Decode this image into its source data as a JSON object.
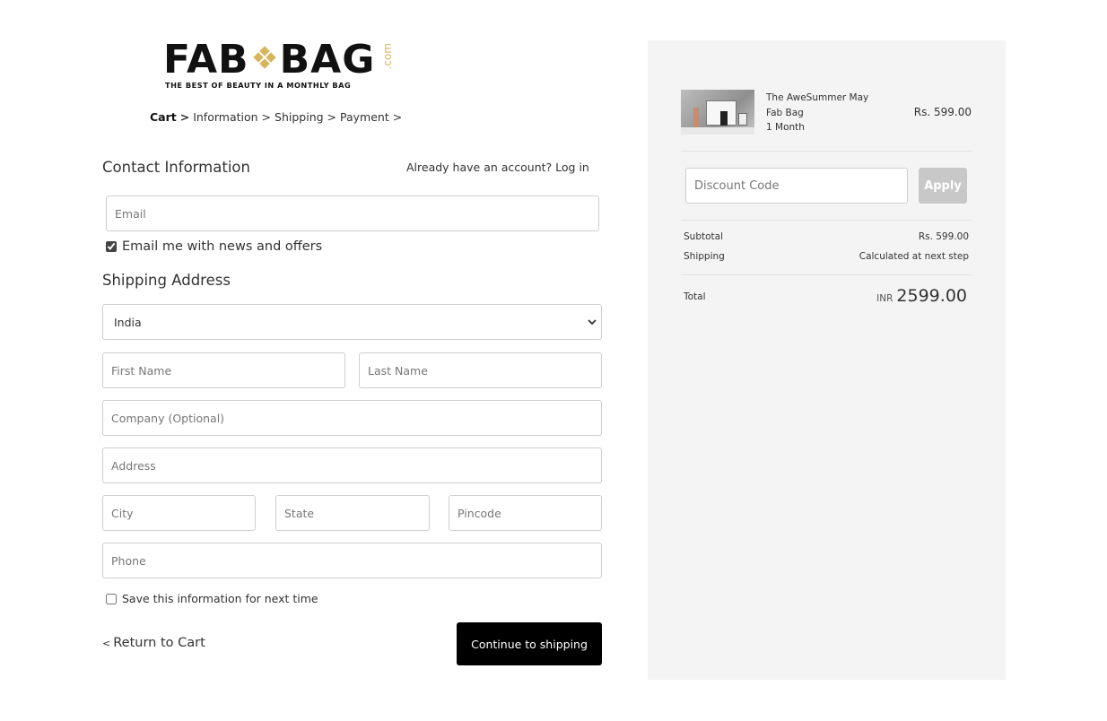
{
  "brand": {
    "logo_word1": "FAB",
    "logo_word2": "BAG",
    "logo_com": ".com",
    "tagline": "THE BEST OF BEAUTY IN A MONTHLY BAG",
    "accent_color": "#d8b45b"
  },
  "breadcrumb": {
    "items": [
      "Cart",
      "Information",
      "Shipping",
      "Payment"
    ],
    "separator": ">",
    "active": "Cart"
  },
  "contact": {
    "title": "Contact Information",
    "login_prompt": "Already have an account? Log in",
    "email_placeholder": "Email",
    "newsletter_label": "Email me with news and offers",
    "newsletter_checked": true
  },
  "shipping": {
    "title": "Shipping Address",
    "country_selected": "India",
    "first_name_placeholder": "First Name",
    "last_name_placeholder": "Last Name",
    "company_placeholder": "Company (Optional)",
    "address_placeholder": "Address",
    "city_placeholder": "City",
    "state_placeholder": "State",
    "pincode_placeholder": "Pincode",
    "phone_placeholder": "Phone",
    "save_info_label": "Save this information for next time",
    "save_info_checked": false
  },
  "actions": {
    "return_label": "Return to Cart",
    "return_icon": "chevron-left-icon",
    "continue_label": "Continue to shipping",
    "continue_bg": "#000000"
  },
  "summary": {
    "product": {
      "name_line1": "The AweSummer May",
      "name_line2": "Fab Bag",
      "name_line3": "1 Month",
      "price": "Rs. 599.00"
    },
    "discount_placeholder": "Discount Code",
    "apply_label": "Apply",
    "subtotal_label": "Subtotal",
    "subtotal_value": "Rs. 599.00",
    "shipping_label": "Shipping",
    "shipping_value": "Calculated at next step",
    "total_label": "Total",
    "total_currency": "INR",
    "total_value": "2599.00",
    "panel_bg": "#f4f4f4"
  }
}
